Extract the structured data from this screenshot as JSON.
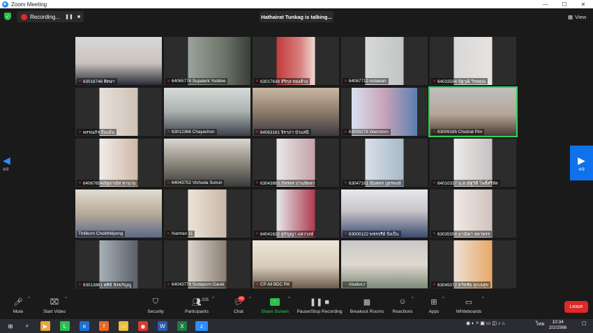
{
  "window": {
    "title": "Zoom Meeting"
  },
  "topbar": {
    "recording_label": "Recording...",
    "talking_banner": "Hathairat Tunkag is talking...",
    "view_label": "View"
  },
  "nav": {
    "left_page": "4/9",
    "right_page": "4/9"
  },
  "participants": [
    {
      "name": "63018746 ศิตษา"
    },
    {
      "name": "64065774 Supalerk Yoddee"
    },
    {
      "name": "63017638 สิริกุล ทองด้วง"
    },
    {
      "name": "64067712 nutawan"
    },
    {
      "name": "64033594 นัฐวุฒิ วิรยคุณ"
    },
    {
      "name": "พรรณกิร ถึงแม้น"
    },
    {
      "name": "63012366 Chayachon"
    },
    {
      "name": "64063161 จิราภา บัวแสนี"
    },
    {
      "name": "63009278 Warintorn"
    },
    {
      "name": "63009165 Chutirat Pim"
    },
    {
      "name": "64067654ณัฐยาณัส หานาม"
    },
    {
      "name": "64043752 Vichuda Sunun"
    },
    {
      "name": "63043863 ภัทรพร ปานขัดลา"
    },
    {
      "name": "63047161 นันทพร ภูธรพงษ์"
    },
    {
      "name": "64010337 น.ส.ณัฐวิดี โพธิ์ศรีลัต"
    },
    {
      "name": "Thitikorn Chokthitipong"
    },
    {
      "name": "Namtan 11"
    },
    {
      "name": "64041632 สุกัญญา แคววงษ์"
    },
    {
      "name": "63000122 พชรจรีย์ ปั่งเป็น"
    },
    {
      "name": "63035554 มาณิดา หลาพรร"
    },
    {
      "name": "63013861 ศศิธ์ สังขกัญญู"
    },
    {
      "name": "64043776 Sudaporn Darak"
    },
    {
      "name": "CP All BDC RK"
    },
    {
      "name": "nisalux.r"
    },
    {
      "name": "63045072 ธวัชชัย ลุกเลสุข"
    }
  ],
  "toolbar": {
    "mute": "Mute",
    "start_video": "Start Video",
    "security": "Security",
    "participants": "Participants",
    "participants_count": "205",
    "chat": "Chat",
    "chat_badge": "69",
    "share_screen": "Share Screen",
    "pause_stop_recording": "Pause/Stop Recording",
    "breakout_rooms": "Breakout Rooms",
    "reactions": "Reactions",
    "apps": "Apps",
    "whiteboards": "Whiteboards",
    "leave": "Leave"
  },
  "taskbar": {
    "time": "10:34",
    "date": "2/2/2566",
    "language": "ไทย"
  },
  "colors": {
    "background": "#1a1a1a",
    "active_speaker": "#2bd55a",
    "leave": "#e02828",
    "accent": "#0e72ed"
  }
}
